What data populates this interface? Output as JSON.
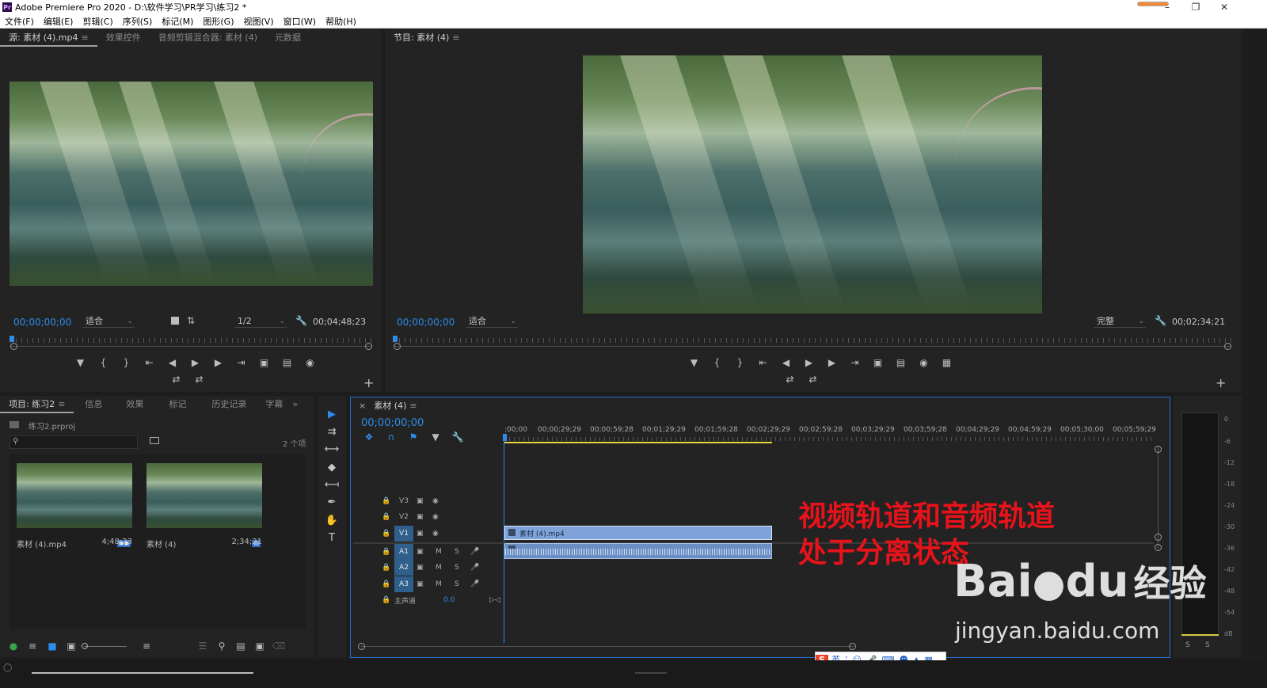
{
  "window": {
    "title": "Adobe Premiere Pro 2020 - D:\\软件学习\\PR学习\\练习2 *",
    "app_icon": "Pr"
  },
  "menu": [
    "文件(F)",
    "编辑(E)",
    "剪辑(C)",
    "序列(S)",
    "标记(M)",
    "图形(G)",
    "视图(V)",
    "窗口(W)",
    "帮助(H)"
  ],
  "source_panel": {
    "tabs": [
      "源: 素材 (4).mp4",
      "效果控件",
      "音频剪辑混合器: 素材 (4)",
      "元数据"
    ],
    "timecode": "00;00;00;00",
    "fit_value": "适合",
    "resolution": "1/2",
    "duration": "00;04;48;23"
  },
  "program_panel": {
    "tab": "节目: 素材 (4)",
    "timecode": "00;00;00;00",
    "fit_value": "适合",
    "quality": "完整",
    "duration": "00;02;34;21"
  },
  "project_panel": {
    "tabs": [
      "项目: 练习2",
      "信息",
      "效果",
      "标记",
      "历史记录",
      "字幕"
    ],
    "file_name": "练习2.prproj",
    "item_count": "2 个项",
    "items": [
      {
        "name": "素材 (4).mp4",
        "duration": "4;48;23"
      },
      {
        "name": "素材 (4)",
        "duration": "2;34;21"
      }
    ]
  },
  "timeline": {
    "tab": "素材 (4)",
    "timecode": "00;00;00;00",
    "ruler": [
      ":00;00",
      "00;00;29;29",
      "00;00;59;28",
      "00;01;29;29",
      "00;01;59;28",
      "00;02;29;29",
      "00;02;59;28",
      "00;03;29;29",
      "00;03;59;28",
      "00;04;29;29",
      "00;04;59;29",
      "00;05;30;00",
      "00;05;59;29"
    ],
    "tracks": [
      {
        "name": "V3",
        "kind": "video"
      },
      {
        "name": "V2",
        "kind": "video"
      },
      {
        "name": "V1",
        "kind": "video"
      },
      {
        "name": "A1",
        "kind": "audio"
      },
      {
        "name": "A2",
        "kind": "audio"
      },
      {
        "name": "A3",
        "kind": "audio"
      }
    ],
    "master_label": "主声道",
    "master_value": "0.0",
    "mute_label": "M",
    "solo_label": "S",
    "clip_label": "素材 (4).mp4"
  },
  "annotation": {
    "line1": "视频轨道和音频轨道",
    "line2": "处于分离状态",
    "color": "#e8131a"
  },
  "meter": {
    "labels": [
      "0",
      "-6",
      "-12",
      "-18",
      "-24",
      "-30",
      "-36",
      "-42",
      "-48",
      "-54",
      "dB"
    ],
    "solo_buttons": [
      "S",
      "S"
    ]
  },
  "watermark": {
    "brand": "Bai",
    "brand_suffix": "du",
    "experience": "经验",
    "url": "jingyan.baidu.com"
  },
  "ime_bar": {
    "lang": "英"
  },
  "colors": {
    "accent_blue": "#2d8ceb",
    "track_on": "#2f5f8a",
    "clip_video": "#7fa3d8",
    "clip_audio": "#6b8fc4"
  }
}
